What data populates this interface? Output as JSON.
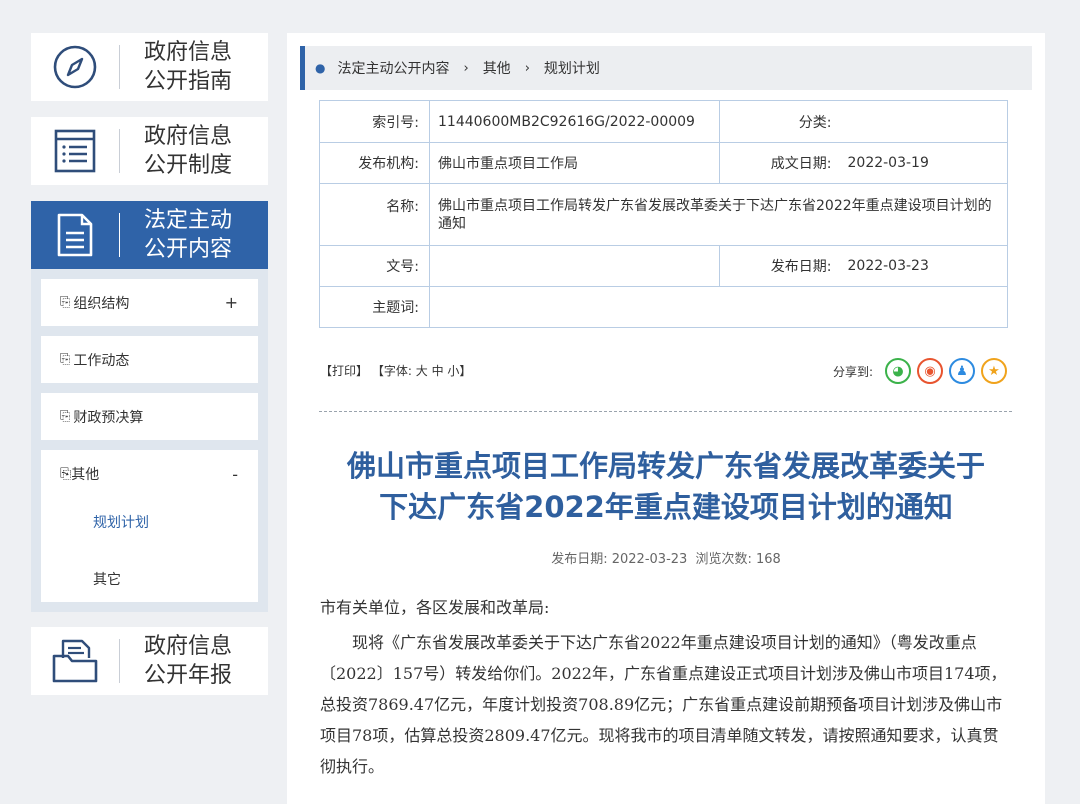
{
  "sidebar": {
    "cards": [
      {
        "line1": "政府信息",
        "line2": "公开指南",
        "icon": "compass-icon"
      },
      {
        "line1": "政府信息",
        "line2": "公开制度",
        "icon": "list-doc-icon"
      },
      {
        "line1": "法定主动",
        "line2": "公开内容",
        "icon": "document-icon"
      },
      {
        "line1": "政府信息",
        "line2": "公开年报",
        "icon": "folder-doc-icon"
      }
    ],
    "sub_items": [
      {
        "label": "组织结构",
        "toggle": "+"
      },
      {
        "label": "工作动态",
        "toggle": ""
      },
      {
        "label": "财政预决算",
        "toggle": ""
      },
      {
        "label": "其他",
        "toggle": "-"
      }
    ],
    "sub_sub_items": [
      "规划计划",
      "其它"
    ]
  },
  "breadcrumb": [
    "法定主动公开内容",
    "其他",
    "规划计划"
  ],
  "meta": {
    "index_label": "索引号:",
    "index_value": "11440600MB2C92616G/2022-00009",
    "category_label": "分类:",
    "category_value": "",
    "org_label": "发布机构:",
    "org_value": "佛山市重点项目工作局",
    "created_label": "成文日期:",
    "created_value": "2022-03-19",
    "name_label": "名称:",
    "name_value": "佛山市重点项目工作局转发广东省发展改革委关于下达广东省2022年重点建设项目计划的通知",
    "docno_label": "文号:",
    "docno_value": "",
    "pub_label": "发布日期:",
    "pub_value": "2022-03-23",
    "keyword_label": "主题词:",
    "keyword_value": ""
  },
  "tools": {
    "print": "【打印】",
    "font_prefix": "【字体:",
    "font_large": "大",
    "font_medium": "中",
    "font_small": "小",
    "font_suffix": "】",
    "share_label": "分享到:"
  },
  "article": {
    "title_line1": "佛山市重点项目工作局转发广东省发展改革委关于",
    "title_line2": "下达广东省2022年重点建设项目计划的通知",
    "pubdate": "发布日期: 2022-03-23",
    "views": "浏览次数: 168",
    "greeting": "市有关单位，各区发展和改革局:",
    "para1": "现将《广东省发展改革委关于下达广东省2022年重点建设项目计划的通知》（粤发改重点〔2022〕157号）转发给你们。2022年，广东省重点建设正式项目计划涉及佛山市项目174项，总投资7869.47亿元，年度计划投资708.89亿元；广东省重点建设前期预备项目计划涉及佛山市项目78项，估算总投资2809.47亿元。现将我市的项目清单随文转发，请按照通知要求，认真贯彻执行。"
  },
  "colors": {
    "accent": "#2f63a8",
    "title": "#2f5f9e",
    "wechat": "#3bb24a",
    "weibo": "#e8542f",
    "qq": "#2d8be0",
    "fav": "#f0a31c"
  }
}
